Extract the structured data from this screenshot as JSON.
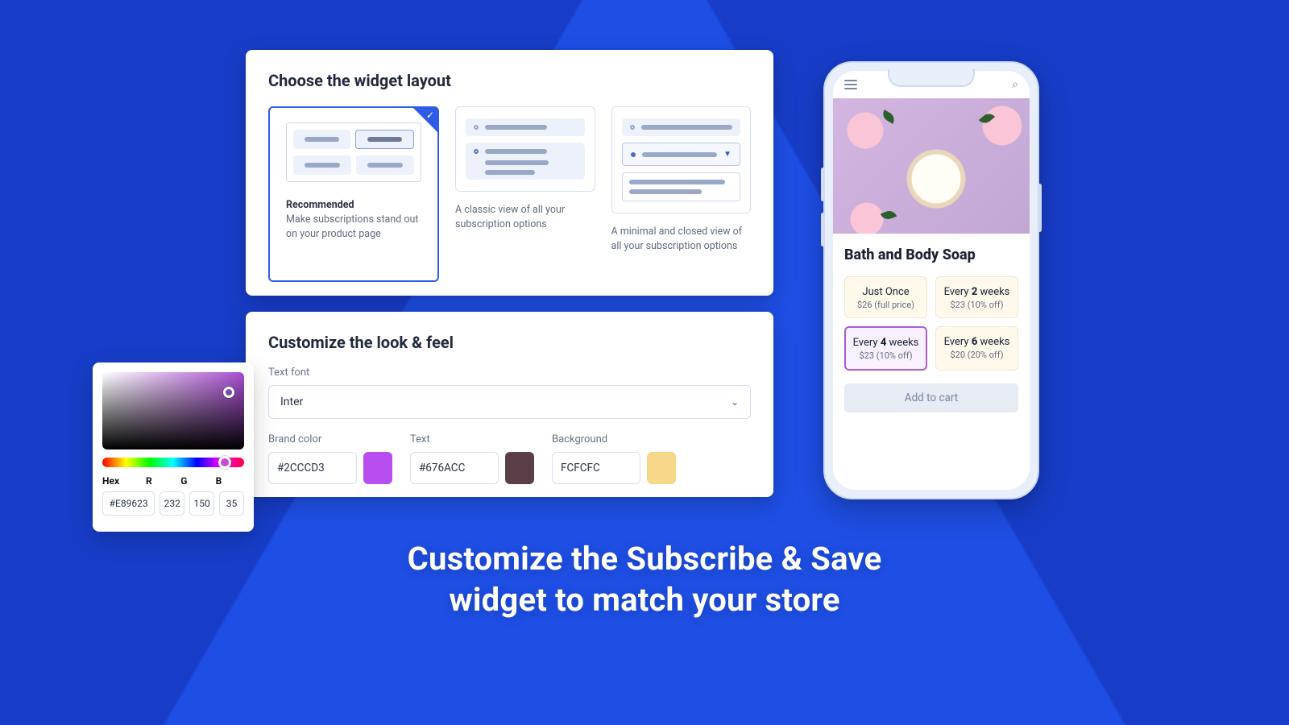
{
  "layoutCard": {
    "title": "Choose the widget layout",
    "options": [
      {
        "title": "Recommended",
        "caption": "Make subscriptions stand out on your product page",
        "selected": true
      },
      {
        "caption": "A classic view of all your subscription options"
      },
      {
        "caption": "A minimal and closed view of all your subscription options"
      }
    ]
  },
  "lookCard": {
    "title": "Customize the look & feel",
    "fontLabel": "Text font",
    "fontValue": "Inter",
    "brandLabel": "Brand color",
    "brandHex": "#2CCCD3",
    "brandSwatch": "#b84ef0",
    "textLabel": "Text",
    "textHex": "#676ACC",
    "textSwatch": "#5a3f49",
    "bgLabel": "Background",
    "bgHex": "FCFCFC",
    "bgSwatch": "#f6d78a"
  },
  "picker": {
    "labels": {
      "hex": "Hex",
      "r": "R",
      "g": "G",
      "b": "B"
    },
    "hex": "#E89623",
    "r": "232",
    "g": "150",
    "b": "35"
  },
  "phone": {
    "productTitle": "Bath and Body Soap",
    "plans": [
      {
        "title_pre": "Just Once",
        "title_bold": "",
        "title_post": "",
        "sub": "$26 (full price)"
      },
      {
        "title_pre": "Every ",
        "title_bold": "2",
        "title_post": " weeks",
        "sub": "$23 (10% off)"
      },
      {
        "title_pre": "Every ",
        "title_bold": "4",
        "title_post": " weeks",
        "sub": "$23 (10% off)",
        "selected": true
      },
      {
        "title_pre": "Every ",
        "title_bold": "6",
        "title_post": " weeks",
        "sub": "$20 (20% off)"
      }
    ],
    "cart": "Add to cart"
  },
  "headline": {
    "l1": "Customize the Subscribe & Save",
    "l2": "widget to match your store"
  }
}
